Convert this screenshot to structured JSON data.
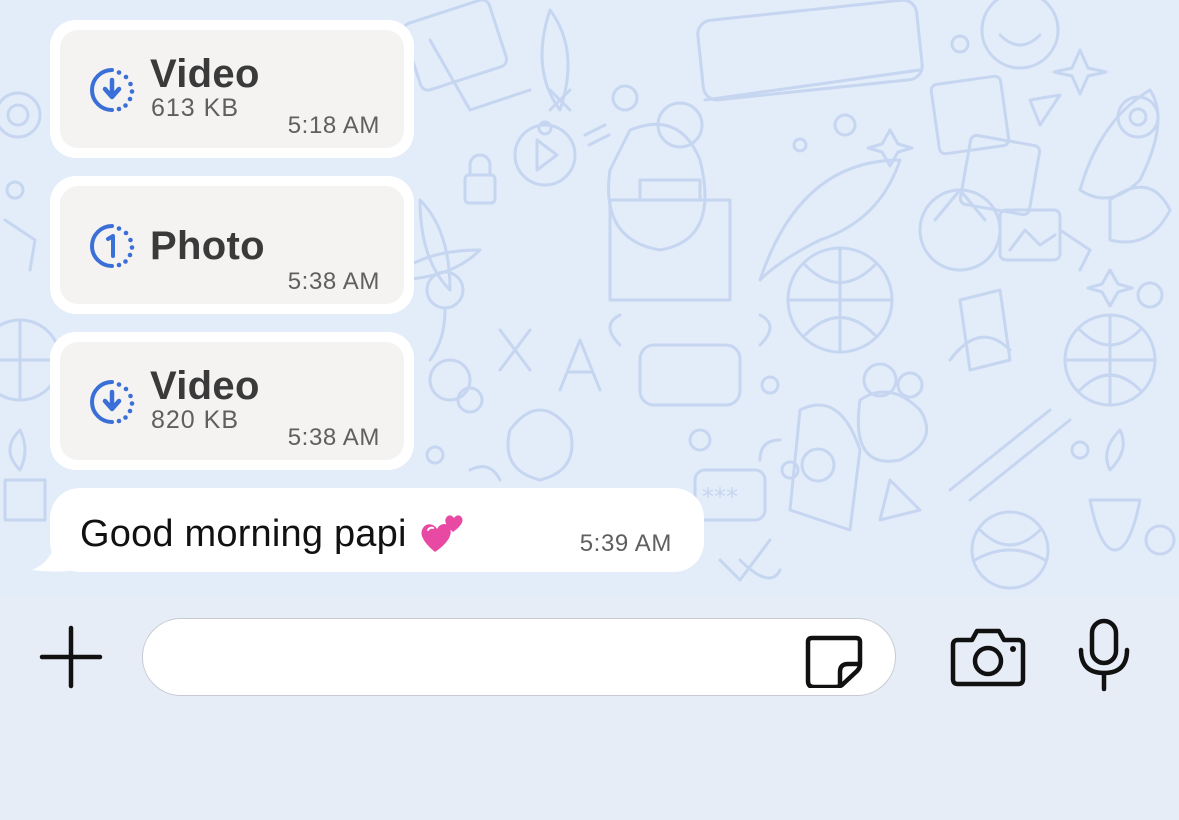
{
  "messages": [
    {
      "kind": "video",
      "title": "Video",
      "size": "613 KB",
      "time": "5:18 AM",
      "icon": "download-pending-icon"
    },
    {
      "kind": "photo",
      "title": "Photo",
      "time": "5:38 AM",
      "icon": "photo-view-once-icon"
    },
    {
      "kind": "video",
      "title": "Video",
      "size": "820 KB",
      "time": "5:38 AM",
      "icon": "download-pending-icon"
    },
    {
      "kind": "text",
      "text": "Good morning papi",
      "emoji": "two-hearts-emoji",
      "time": "5:39 AM"
    }
  ],
  "composer": {
    "input_value": "",
    "input_placeholder": "",
    "icons": [
      "plus-icon",
      "sticker-icon",
      "camera-icon",
      "microphone-icon"
    ]
  },
  "colors": {
    "wallpaper": "#e3ecf9",
    "doodle": "#c3d4f0",
    "accent_blue": "#3b6fd8",
    "bubble": "#ffffff",
    "media_card": "#f4f3f2",
    "composer_bg": "#e7edf7"
  }
}
